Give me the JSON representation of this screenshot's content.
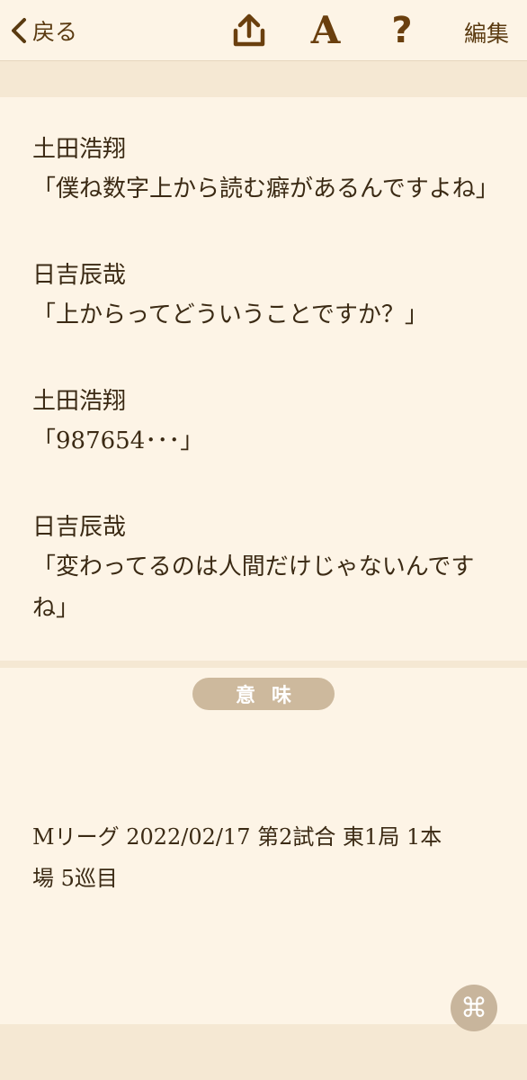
{
  "toolbar": {
    "back_label": "戻る",
    "font_glyph": "A",
    "help_glyph": "?",
    "edit_label": "編集"
  },
  "dialogue": [
    {
      "speaker": "土田浩翔",
      "line": "「僕ね数字上から読む癖があるんですよね」"
    },
    {
      "speaker": "日吉辰哉",
      "line": "「上からってどういうことですか？」"
    },
    {
      "speaker": "土田浩翔",
      "line": "「987654･･･」"
    },
    {
      "speaker": "日吉辰哉",
      "line_1": "「変わってるのは人間だけじゃないんです",
      "line_2": "ね」"
    }
  ],
  "meaning": {
    "label": "意味",
    "source_line_1": "Mリーグ 2022/02/17 第2試合 東1局 1本",
    "source_line_2": "場 5巡目"
  },
  "command_button": {
    "glyph": "⌘"
  },
  "colors": {
    "background": "#fdf4e6",
    "band": "#f5e8d3",
    "text": "#3b2a14",
    "accent_brown": "#6a3f0e",
    "pill": "#cdb99d"
  },
  "icons": [
    "chevron-left-icon",
    "upload-icon",
    "font-icon",
    "help-icon",
    "command-icon"
  ]
}
